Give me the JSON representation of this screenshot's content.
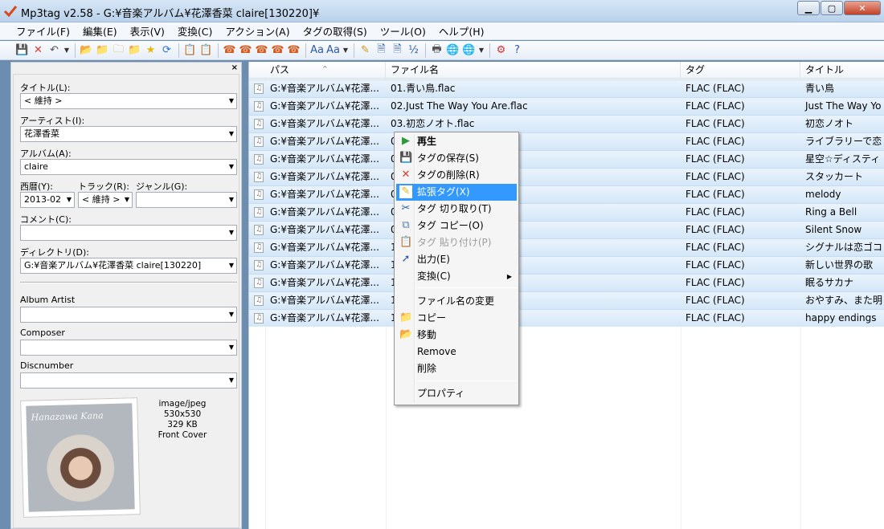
{
  "window": {
    "title": "Mp3tag v2.58  -  G:¥音楽アルバム¥花澤香菜 claire[130220]¥"
  },
  "menubar": [
    "ファイル(F)",
    "編集(E)",
    "表示(V)",
    "変換(C)",
    "アクション(A)",
    "タグの取得(S)",
    "ツール(O)",
    "ヘルプ(H)"
  ],
  "tag_panel": {
    "title_label": "タイトル(L):",
    "title_value": "< 維持 >",
    "artist_label": "アーティスト(I):",
    "artist_value": "花澤香菜",
    "album_label": "アルバム(A):",
    "album_value": "claire",
    "year_label": "西暦(Y):",
    "year_value": "2013-02",
    "track_label": "トラック(R):",
    "track_value": "< 維持 >",
    "genre_label": "ジャンル(G):",
    "genre_value": "",
    "comment_label": "コメント(C):",
    "comment_value": "",
    "directory_label": "ディレクトリ(D):",
    "directory_value": "G:¥音楽アルバム¥花澤香菜 claire[130220]",
    "album_artist_label": "Album Artist",
    "album_artist_value": "",
    "composer_label": "Composer",
    "composer_value": "",
    "discnumber_label": "Discnumber",
    "discnumber_value": "",
    "cover_text": "Hanazawa Kana",
    "image_info": {
      "type": "image/jpeg",
      "size": "530x530",
      "filesize": "329 KB",
      "kind": "Front Cover"
    }
  },
  "columns": [
    "パス",
    "ファイル名",
    "タグ",
    "タイトル"
  ],
  "files": [
    {
      "path": "G:¥音楽アルバム¥花澤...",
      "filename": "01.青い鳥.flac",
      "tag": "FLAC (FLAC)",
      "title": "青い鳥"
    },
    {
      "path": "G:¥音楽アルバム¥花澤...",
      "filename": "02.Just The Way You Are.flac",
      "tag": "FLAC (FLAC)",
      "title": "Just The Way Yo"
    },
    {
      "path": "G:¥音楽アルバム¥花澤...",
      "filename": "03.初恋ノオト.flac",
      "tag": "FLAC (FLAC)",
      "title": "初恋ノオト"
    },
    {
      "path": "G:¥音楽アルバム¥花澤...",
      "filename": "0                    .flac",
      "tag": "FLAC (FLAC)",
      "title": "ライブラリーで恋"
    },
    {
      "path": "G:¥音楽アルバム¥花澤...",
      "filename": "0                    ン.flac",
      "tag": "FLAC (FLAC)",
      "title": "星空☆ディスティ"
    },
    {
      "path": "G:¥音楽アルバム¥花澤...",
      "filename": "0",
      "tag": "FLAC (FLAC)",
      "title": "スタッカート"
    },
    {
      "path": "G:¥音楽アルバム¥花澤...",
      "filename": "0",
      "tag": "FLAC (FLAC)",
      "title": "melody"
    },
    {
      "path": "G:¥音楽アルバム¥花澤...",
      "filename": "0",
      "tag": "FLAC (FLAC)",
      "title": "Ring a Bell"
    },
    {
      "path": "G:¥音楽アルバム¥花澤...",
      "filename": "0",
      "tag": "FLAC (FLAC)",
      "title": "Silent Snow"
    },
    {
      "path": "G:¥音楽アルバム¥花澤...",
      "filename": "1",
      "tag": "FLAC (FLAC)",
      "title": "シグナルは恋ゴコ"
    },
    {
      "path": "G:¥音楽アルバム¥花澤...",
      "filename": "1",
      "tag": "FLAC (FLAC)",
      "title": "新しい世界の歌"
    },
    {
      "path": "G:¥音楽アルバム¥花澤...",
      "filename": "1",
      "tag": "FLAC (FLAC)",
      "title": "眠るサカナ"
    },
    {
      "path": "G:¥音楽アルバム¥花澤...",
      "filename": "1",
      "tag": "FLAC (FLAC)",
      "title": "おやすみ、また明"
    },
    {
      "path": "G:¥音楽アルバム¥花澤...",
      "filename": "1",
      "tag": "FLAC (FLAC)",
      "title": "happy endings"
    }
  ],
  "context_menu": [
    {
      "label": "再生",
      "icon": "play-icon"
    },
    {
      "label": "タグの保存(S)",
      "icon": "save-icon"
    },
    {
      "label": "タグの削除(R)",
      "icon": "delete-x-icon"
    },
    {
      "label": "拡張タグ(X)",
      "icon": "extended-tag-icon"
    },
    {
      "label": "タグ 切り取り(T)",
      "icon": "scissors-icon"
    },
    {
      "label": "タグ コピー(O)",
      "icon": "copy-icon"
    },
    {
      "label": "タグ 貼り付け(P)",
      "icon": "paste-icon"
    },
    {
      "label": "出力(E)",
      "icon": "export-icon"
    },
    {
      "label": "変換(C)",
      "icon": ""
    },
    {
      "label": "ファイル名の変更",
      "icon": ""
    },
    {
      "label": "コピー",
      "icon": "folder-copy-icon"
    },
    {
      "label": "移動",
      "icon": "folder-move-icon"
    },
    {
      "label": "Remove",
      "icon": ""
    },
    {
      "label": "削除",
      "icon": ""
    },
    {
      "label": "プロパティ",
      "icon": ""
    }
  ],
  "colors": {
    "selection": "#3399ff",
    "row_selected": "#d5e7f8",
    "delete_red": "#d83b2a"
  }
}
